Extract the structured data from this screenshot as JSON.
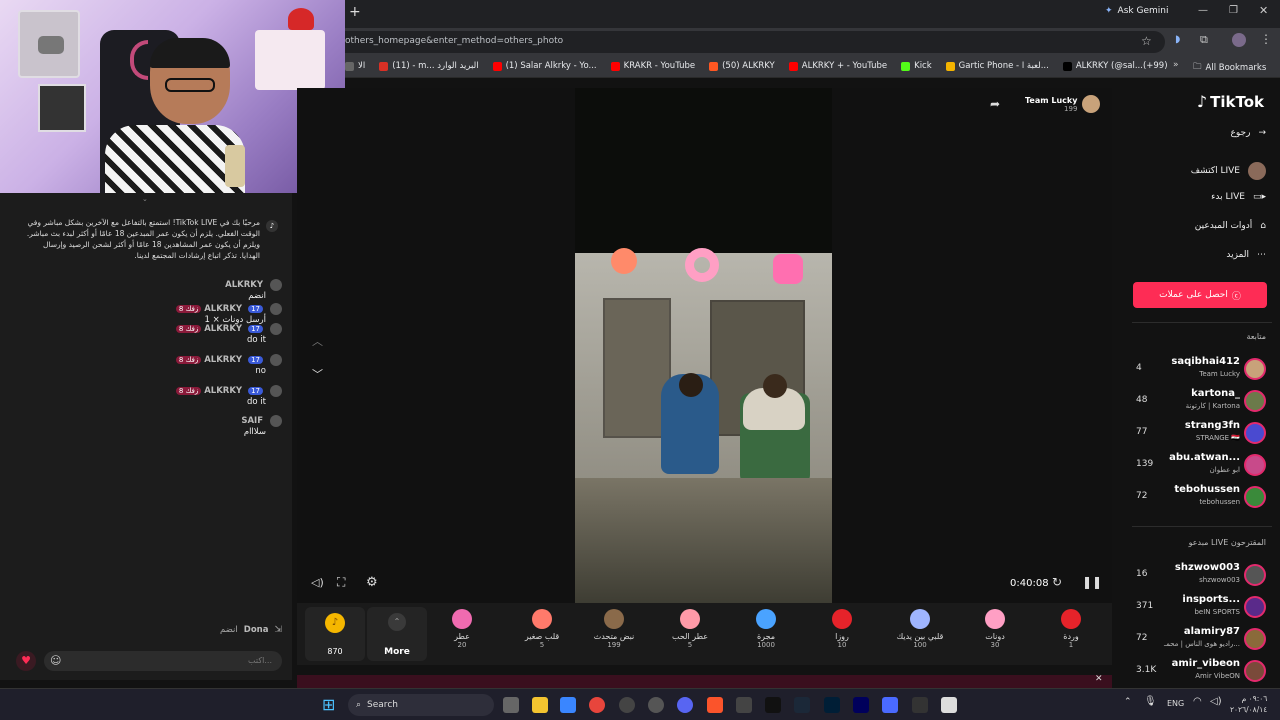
{
  "browser": {
    "new_tab": "+",
    "ask_gemini": "Ask Gemini",
    "url": "others_homepage&enter_method=others_photo",
    "bookmarks": [
      {
        "label": "الا",
        "color": "#666"
      },
      {
        "label": "(11) - m... البريد الوارد",
        "color": "#d93025"
      },
      {
        "label": "(1) Salar Alkrky - Yo...",
        "color": "#ff0000"
      },
      {
        "label": "KRAKR - YouTube",
        "color": "#ff0000"
      },
      {
        "label": "(50) ALKRKY",
        "color": "#ff5722"
      },
      {
        "label": "ALKRKY + - YouTube",
        "color": "#ff0000"
      },
      {
        "label": "Kick",
        "color": "#53fc18"
      },
      {
        "label": "Gartic Phone - لعبة ا...",
        "color": "#f4b400"
      },
      {
        "label": "ALKRKY (@sal...(+99)",
        "color": "#000"
      }
    ],
    "all_bookmarks": "All Bookmarks"
  },
  "chat": {
    "welcome": "مرحبًا بك في TikTok LIVE! استمتع بالتفاعل مع الآخرين بشكل مباشر وفي الوقت الفعلي. يلزم أن يكون عمر المبدعين 18 عامًا أو أكثر لبدء بث مباشر. ويلزم أن يكون عمر المشاهدين 18 عامًا أو أكثر لشحن الرصيد وإرسال الهدايا. تذكر اتباع إرشادات المجتمع لدينا.",
    "messages": [
      {
        "user": "ALKRKY",
        "text": "انضم",
        "level": "",
        "fan": ""
      },
      {
        "user": "ALKRKY",
        "text": "أرسل دونات  × 1",
        "level": "17",
        "fan": "زفك 8"
      },
      {
        "user": "ALKRKY",
        "text": "do it",
        "level": "17",
        "fan": "زفك 8"
      },
      {
        "user": "ALKRKY",
        "text": "no",
        "level": "17",
        "fan": "زفك 8"
      },
      {
        "user": "ALKRKY",
        "text": "do it",
        "level": "17",
        "fan": "زفك 8"
      },
      {
        "user": "SAIF",
        "text": "سلااام",
        "level": "",
        "fan": ""
      }
    ],
    "join": {
      "user": "Dona",
      "text": "انضم"
    },
    "input_placeholder": "اكتب..."
  },
  "host": {
    "name": "Team Lucky",
    "viewers": "199"
  },
  "player": {
    "time": "0:40:08"
  },
  "coins": {
    "value": "870"
  },
  "gifts": {
    "more": "More",
    "items": [
      {
        "name": "عطر",
        "price": "20",
        "color": "#f06bb0"
      },
      {
        "name": "قلب صغير",
        "price": "5",
        "color": "#ff7a6b"
      },
      {
        "name": "نبض متحدث",
        "price": "199",
        "color": "#8a6a4a"
      },
      {
        "name": "عطر الحب",
        "price": "5",
        "color": "#ff9aa8"
      },
      {
        "name": "مجرة",
        "price": "1000",
        "color": "#4aa3ff"
      },
      {
        "name": "روزا",
        "price": "10",
        "color": "#e6232a"
      },
      {
        "name": "قلبي بين يديك",
        "price": "100",
        "color": "#9fb5ff"
      },
      {
        "name": "دونات",
        "price": "30",
        "color": "#ff9fc4"
      },
      {
        "name": "وردة",
        "price": "1",
        "color": "#e6232a"
      }
    ]
  },
  "sidebar": {
    "logo": "TikTok",
    "back": "رجوع",
    "explore": "اكتشف LIVE",
    "go_live": "بدء LIVE",
    "tools": "أدوات المبدعين",
    "more": "المزيد",
    "coins_button": "احصل على عملات",
    "following_title": "متابعة",
    "following": [
      {
        "count": "4",
        "name": "saqibhai412",
        "sub": "Team Lucky",
        "color": "#c8a27a"
      },
      {
        "count": "48",
        "name": "kartona_",
        "sub": "كارتونة | Kartona",
        "color": "#6b7a4a"
      },
      {
        "count": "77",
        "name": "strang3fn",
        "sub": "STRANGE 🇮🇶",
        "color": "#4a4ad0"
      },
      {
        "count": "139",
        "name": "abu.atwan...",
        "sub": "ابو عطوان",
        "color": "#c84a8a"
      },
      {
        "count": "72",
        "name": "tebohussen",
        "sub": "tebohussen",
        "color": "#3a8a3a"
      }
    ],
    "suggested_title": "مبدعو LIVE المقترحون",
    "suggested": [
      {
        "count": "16",
        "name": "shzwow003",
        "sub": "shzwow003",
        "color": "#555"
      },
      {
        "count": "371",
        "name": "insports...",
        "sub": "beIN SPORTS",
        "color": "#5a2a8a"
      },
      {
        "count": "72",
        "name": "alamiry87",
        "sub": "راديو هوى الناس | محمـ...",
        "color": "#8a6a3a"
      },
      {
        "count": "3.1K",
        "name": "amir_vibeon",
        "sub": "Amir VibeON",
        "color": "#7a4a3a"
      }
    ]
  },
  "taskbar": {
    "search": "Search",
    "lang": "ENG",
    "time": "٠٩:٠٦ م",
    "date": "٢٠٢٦/٠٨/١٤"
  }
}
